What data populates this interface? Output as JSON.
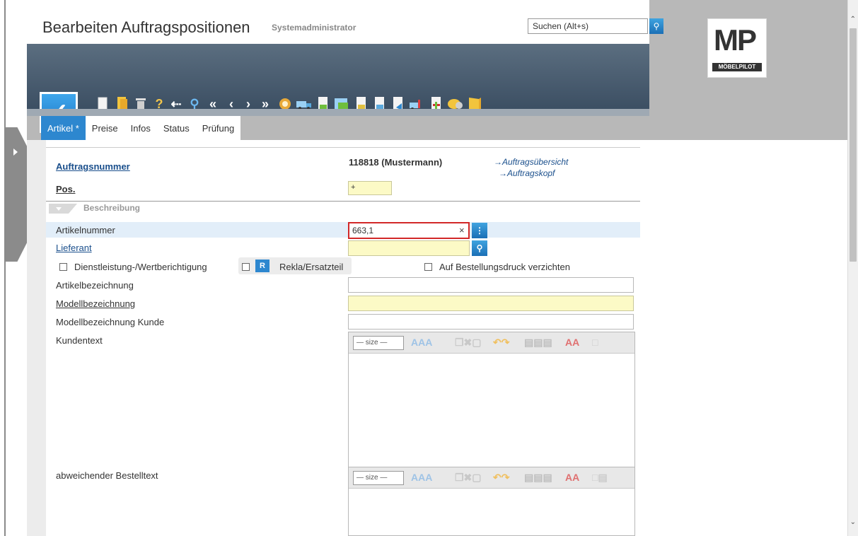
{
  "header": {
    "title": "Bearbeiten Auftragspositionen",
    "subtitle": "Systemadministrator",
    "search_placeholder": "Suchen (Alt+s)",
    "logo_text": "MP",
    "logo_caption": "MÖBELPILOT"
  },
  "toolbar": {
    "confirm_icon": "check-icon",
    "icons_row1": [
      "new-document-icon",
      "copy-document-icon",
      "delete-icon",
      "help-icon",
      "back-icon",
      "search-zoom-icon",
      "first-icon",
      "previous-icon",
      "next-icon",
      "last-icon",
      "discount-icon",
      "truck-icon",
      "document-check-icon",
      "document-edit-icon",
      "document-sheet-icon",
      "document-stack-icon",
      "document-arrow-icon",
      "forklift-icon",
      "document-plus-icon",
      "cash-icon",
      "book-icon"
    ],
    "icons_row2": [
      "calculator-doc-icon",
      "export-doc-icon",
      "tools-add-icon",
      "document-pen-icon",
      "language-flag-icon",
      "settings-orange-icon",
      "print-icon"
    ]
  },
  "tabs": [
    {
      "label": "Artikel *",
      "active": true
    },
    {
      "label": "Preise",
      "active": false
    },
    {
      "label": "Infos",
      "active": false
    },
    {
      "label": "Status",
      "active": false
    },
    {
      "label": "Prüfung",
      "active": false
    }
  ],
  "form": {
    "auftragsnummer_label": "Auftragsnummer",
    "auftragsnummer_value": "118818 (Mustermann)",
    "link_overview": "→Auftragsübersicht",
    "link_head": "→Auftragskopf",
    "pos_label": "Pos.",
    "pos_value": "+",
    "section_title": "Beschreibung",
    "artikelnummer_label": "Artikelnummer",
    "artikelnummer_value": "663,1",
    "clear_symbol": "×",
    "lieferant_label": "Lieferant",
    "lieferant_value": "",
    "dienstleistung_label": "Dienstleistung-/Wertberichtigung",
    "rekla_btn": "R",
    "rekla_label": "Rekla/Ersatzteil",
    "bestelldruck_label": "Auf Bestellungsdruck verzichten",
    "artikelbezeichnung_label": "Artikelbezeichnung",
    "modellbezeichnung_label": "Modellbezeichnung",
    "modellbezeichnung_kunde_label": "Modellbezeichnung Kunde",
    "kundentext_label": "Kundentext",
    "bestelltext_label": "abweichender Bestelltext",
    "size_option": "— size —"
  }
}
